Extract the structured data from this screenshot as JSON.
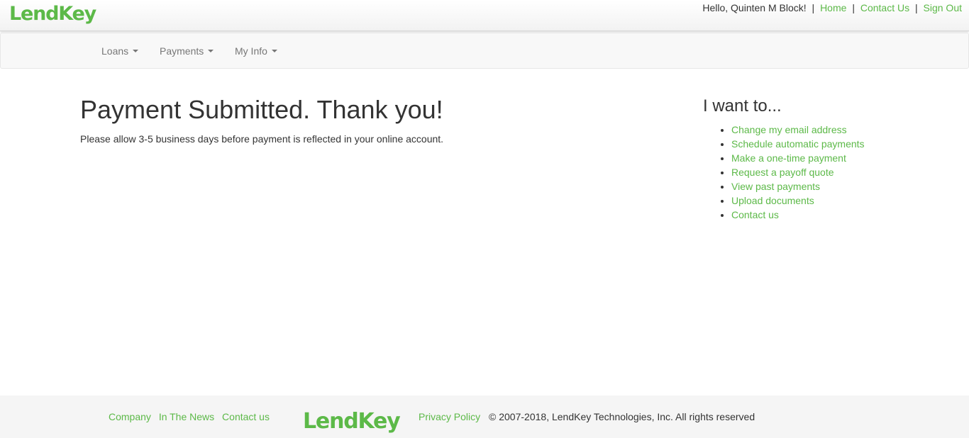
{
  "brand": {
    "logo_text": "LendKey",
    "accent_color": "#5cb948"
  },
  "header": {
    "greeting": "Hello, Quinten M Block!",
    "separator": "|",
    "links": [
      "Home",
      "Contact Us",
      "Sign Out"
    ]
  },
  "nav": {
    "items": [
      {
        "label": "Loans",
        "icon": "caret-down-icon"
      },
      {
        "label": "Payments",
        "icon": "caret-down-icon"
      },
      {
        "label": "My Info",
        "icon": "caret-down-icon"
      }
    ]
  },
  "main": {
    "title": "Payment Submitted. Thank you!",
    "message": "Please allow 3-5 business days before payment is reflected in your online account."
  },
  "sidebar": {
    "heading": "I want to...",
    "links": [
      "Change my email address",
      "Schedule automatic payments",
      "Make a one-time payment",
      "Request a payoff quote",
      "View past payments",
      "Upload documents",
      "Contact us"
    ]
  },
  "footer": {
    "links": [
      "Company",
      "In The News",
      "Contact us"
    ],
    "logo_text": "LendKey",
    "privacy_label": "Privacy Policy",
    "copyright": "© 2007-2018, LendKey Technologies, Inc. All rights reserved"
  }
}
